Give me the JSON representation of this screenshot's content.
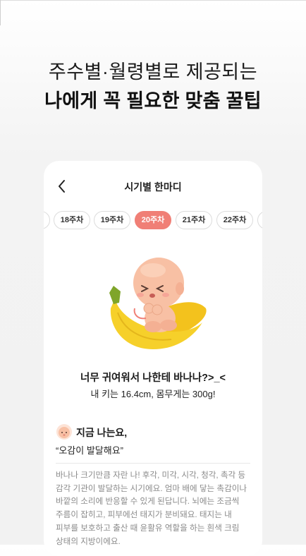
{
  "promo": {
    "line1": "주수별·월령별로 제공되는",
    "line2": "나에게 꼭 필요한 맞춤 꿀팁"
  },
  "card": {
    "title": "시기별 한마디",
    "weeks": [
      "18주차",
      "19주차",
      "20주차",
      "21주차",
      "22주차"
    ],
    "selected_week": "20주차",
    "headline": "너무 귀여워서 나한테 바나나?>_<",
    "subline": "내 키는 16.4cm, 몸무게는 300g!",
    "now_title": "지금 나는요,",
    "quote": "“오감이 발달해요”",
    "body": "바나나 크기만큼 자란 나! 후각, 미각, 시각, 청각, 촉각 등 감각 기관이 발달하는 시기에요. 엄마 배에 닿는 촉감이나 바깥의 소리에 반응할 수 있게 된답니다. 뇌에는 조금씩 주름이 잡히고, 피부에선 태지가 분비돼요. 태지는 내 피부를 보호하고 출산 때 윤활유 역할을 하는 흰색 크림 상태의 지방이에요."
  },
  "colors": {
    "accent": "#f07f76",
    "banana": "#f6d02a",
    "baby": "#f8c0a4"
  },
  "icons": {
    "back": "chevron-left-icon",
    "baby": "baby-face-icon"
  }
}
